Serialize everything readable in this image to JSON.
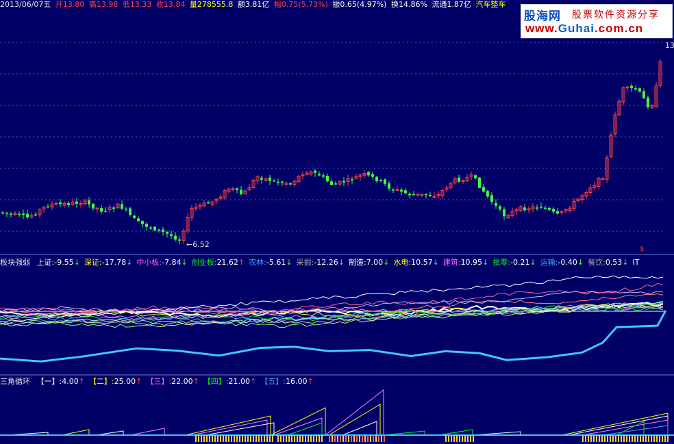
{
  "info_bar": {
    "date": "2013/06/07五",
    "open": "开13.80",
    "high": "高13.98",
    "low": "低13.33",
    "close": "收13.84",
    "volume": "量278555.8",
    "amount": "额3.81亿",
    "change": "幅0.75(5.73%)",
    "amplitude": "振0.65(4.97%)",
    "turnover": "换14.86%",
    "float": "流通1.87亿",
    "sector": "汽车整车"
  },
  "watermark": {
    "logo": "股海网",
    "slogan": "股票软件资源分享",
    "url_prefix": "www.",
    "url_main": "Guhai",
    "url_suffix": ".com.cn"
  },
  "price_panel": {
    "low_label": "←6.52",
    "high_label": "13",
    "marker": "$"
  },
  "sector_panel": {
    "title": "板块强弱",
    "items": [
      {
        "label": "上证:",
        "value": "-9.55",
        "arrow": "↓",
        "color": "#ffffff"
      },
      {
        "label": "深证:",
        "value": "-17.78",
        "arrow": "↓",
        "color": "#ffff00"
      },
      {
        "label": "中小板:",
        "value": "-7.84",
        "arrow": "↓",
        "color": "#ff60ff"
      },
      {
        "label": "创业板:",
        "value": "21.62",
        "arrow": "↑",
        "color": "#00ff00"
      },
      {
        "label": "农林:",
        "value": "-5.61",
        "arrow": "↓",
        "color": "#40a0ff"
      },
      {
        "label": "采掘:",
        "value": "-12.26",
        "arrow": "↓",
        "color": "#a0a0a0"
      },
      {
        "label": "制造:",
        "value": "7.00",
        "arrow": "↓",
        "color": "#ffffff"
      },
      {
        "label": "水电:",
        "value": "10.57",
        "arrow": "↓",
        "color": "#ffff00"
      },
      {
        "label": "建筑:",
        "value": "10.95",
        "arrow": "↓",
        "color": "#ff60ff"
      },
      {
        "label": "批零:",
        "value": "-0.21",
        "arrow": "↓",
        "color": "#00ff00"
      },
      {
        "label": "运输:",
        "value": "-0.40",
        "arrow": "↓",
        "color": "#40a0ff"
      },
      {
        "label": "餐饮:",
        "value": "0.53",
        "arrow": "↓",
        "color": "#a0a0a0"
      },
      {
        "label": "IT",
        "value": "",
        "arrow": "",
        "color": "#ffffff"
      }
    ]
  },
  "triangle_panel": {
    "title": "三角循环",
    "items": [
      {
        "label": "【一】:",
        "value": "4.00",
        "arrow": "↑",
        "color": "#ffffff"
      },
      {
        "label": "【二】:",
        "value": "25.00",
        "arrow": "↑",
        "color": "#ffff00"
      },
      {
        "label": "【三】:",
        "value": "22.00",
        "arrow": "↑",
        "color": "#ff60ff"
      },
      {
        "label": "【四】:",
        "value": "21.00",
        "arrow": "↑",
        "color": "#00ff00"
      },
      {
        "label": "【五】:",
        "value": "16.00",
        "arrow": "↑",
        "color": "#40a0ff"
      }
    ]
  },
  "colors": {
    "background": "#000066",
    "up_candle": "#ff4040",
    "down_candle": "#40ff40",
    "grid": "#5060b0"
  }
}
